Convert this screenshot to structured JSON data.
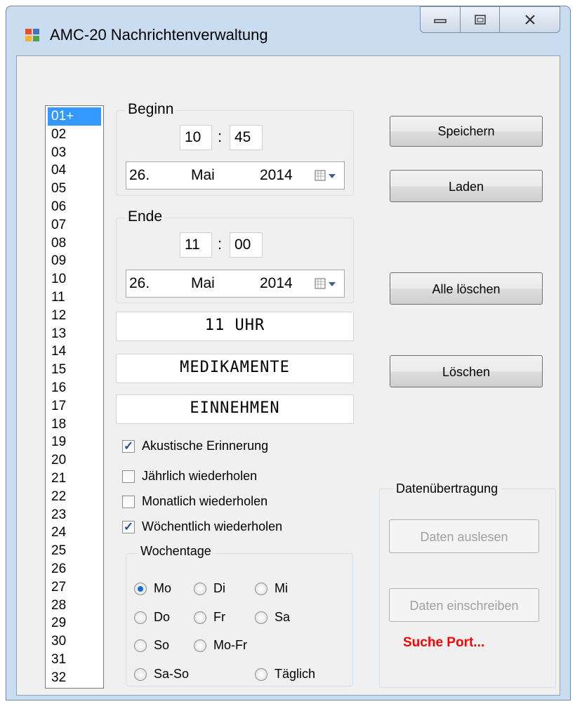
{
  "window": {
    "title": "AMC-20 Nachrichtenverwaltung"
  },
  "slots": [
    "01+",
    "02",
    "03",
    "04",
    "05",
    "06",
    "07",
    "08",
    "09",
    "10",
    "11",
    "12",
    "13",
    "14",
    "15",
    "16",
    "17",
    "18",
    "19",
    "20",
    "21",
    "22",
    "23",
    "24",
    "25",
    "26",
    "27",
    "28",
    "29",
    "30",
    "31",
    "32"
  ],
  "begin": {
    "label": "Beginn",
    "hour": "10",
    "minute": "45",
    "date_day": "26.",
    "date_month": "Mai",
    "date_year": "2014"
  },
  "end": {
    "label": "Ende",
    "hour": "11",
    "minute": "00",
    "date_day": "26.",
    "date_month": "Mai",
    "date_year": "2014"
  },
  "time_separator": ":",
  "message_lines": [
    "11 UHR",
    "MEDIKAMENTE",
    "EINNEHMEN"
  ],
  "options": {
    "acoustic": {
      "label": "Akustische Erinnerung",
      "checked": true
    },
    "yearly": {
      "label": "Jährlich wiederholen",
      "checked": false
    },
    "monthly": {
      "label": "Monatlich wiederholen",
      "checked": false
    },
    "weekly": {
      "label": "Wöchentlich wiederholen",
      "checked": true
    }
  },
  "check_mark": "✓",
  "weekdays": {
    "label": "Wochentage",
    "items": [
      "Mo",
      "Di",
      "Mi",
      "Do",
      "Fr",
      "Sa",
      "So",
      "Mo-Fr",
      "Sa-So",
      "Täglich"
    ],
    "selected": "Mo"
  },
  "buttons": {
    "save": "Speichern",
    "load": "Laden",
    "delete_all": "Alle löschen",
    "delete": "Löschen"
  },
  "transfer": {
    "label": "Datenübertragung",
    "read": "Daten auslesen",
    "write": "Daten einschreiben",
    "status": "Suche Port...",
    "status_color": "#ff0000"
  },
  "icons": [
    "app-icon",
    "minimize-icon",
    "maximize-icon",
    "close-icon",
    "calendar-dropdown-icon"
  ]
}
